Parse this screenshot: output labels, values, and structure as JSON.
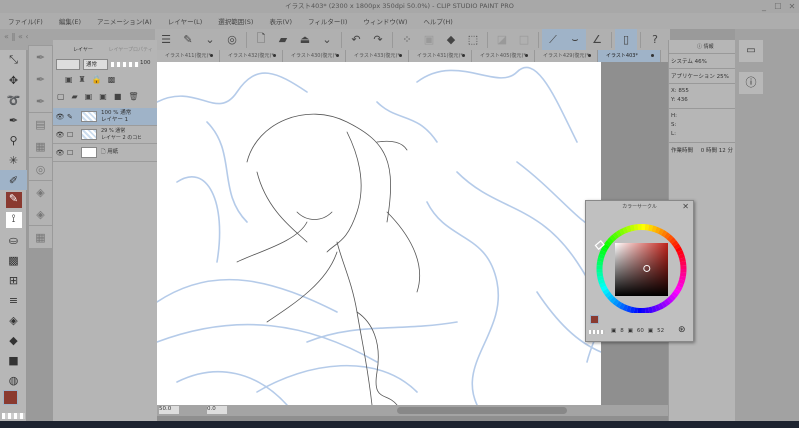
{
  "window": {
    "title": "イラスト403* (2300 x 1800px 350dpi 50.0%)  - CLIP STUDIO PAINT PRO",
    "minimize": "_",
    "maximize": "☐",
    "close": "✕"
  },
  "menu": [
    "ファイル(F)",
    "編集(E)",
    "アニメーション(A)",
    "レイヤー(L)",
    "選択範囲(S)",
    "表示(V)",
    "フィルター(I)",
    "ウィンドウ(W)",
    "ヘルプ(H)"
  ],
  "tabs": [
    {
      "label": "イラスト411(復元)*",
      "active": false
    },
    {
      "label": "イラスト432(復元)*",
      "active": false
    },
    {
      "label": "イラスト430(復元)*",
      "active": false
    },
    {
      "label": "イラスト433(復元)*",
      "active": false
    },
    {
      "label": "イラスト431(復元)*",
      "active": false
    },
    {
      "label": "イラスト405(復元)*",
      "active": false
    },
    {
      "label": "イラスト429(復元)*",
      "active": false
    },
    {
      "label": "イラスト403*",
      "active": true
    }
  ],
  "layer_panel": {
    "tab_layer": "レイヤー",
    "tab_property": "レイヤープロパティ",
    "blend_mode": "通常",
    "opacity": "100",
    "layers": [
      {
        "mode": "100 % 通常",
        "name": "レイヤー 1",
        "selected": true
      },
      {
        "mode": "29 % 通常",
        "name": "レイヤー 2 のコピー",
        "selected": false
      },
      {
        "mode": "",
        "name": "用紙",
        "selected": false
      }
    ]
  },
  "info_panel": {
    "tab": "情報",
    "system": "システム 46%",
    "application": "アプリケーション 25%",
    "x_label": "X:",
    "x": "855",
    "y_label": "Y:",
    "y": "436",
    "h_label": "H:",
    "s_label": "S:",
    "l_label": "L:",
    "work_time_label": "作業時間",
    "work_time": "0 時間 12 分"
  },
  "color_circle": {
    "title": "カラーサークル",
    "h": "8",
    "s": "60",
    "v": "52",
    "main_color": "#8a3a30",
    "sub_color": "#000000",
    "hue": 8,
    "saturation": 60,
    "value": 52
  },
  "status": {
    "zoom": "50.0",
    "angle": "0.0"
  },
  "colors": {
    "accent": "#9fb3c8",
    "main_color": "#8a3a30"
  }
}
